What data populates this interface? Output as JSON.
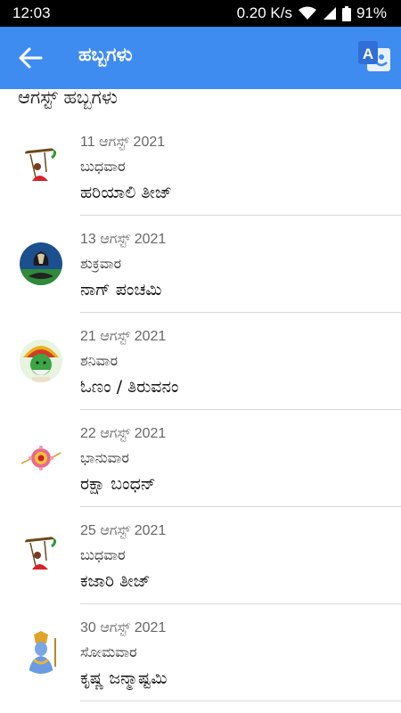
{
  "status": {
    "time": "12:03",
    "speed": "0.20 K/s",
    "battery": "91%"
  },
  "appbar": {
    "title": "ಹಬ್ಬಗಳು",
    "back_icon": "back-arrow-icon",
    "translate_icon": "translate-icon",
    "color": "#3f8cf0"
  },
  "section": {
    "header": "ಆಗಸ್ಟ್ ಹಬ್ಬಗಳು"
  },
  "festivals": [
    {
      "date": "11 ಆಗಸ್ಟ್ 2021",
      "day": "ಬುಧವಾರ",
      "name": "ಹರಿಯಾಲಿ ತೀಜ್",
      "icon": "swing-woman-icon"
    },
    {
      "date": "13 ಆಗಸ್ಟ್ 2021",
      "day": "ಶುಕ್ರವಾರ",
      "name": "ನಾಗ್ ಪಂಚಮಿ",
      "icon": "cobra-icon"
    },
    {
      "date": "21 ಆಗಸ್ಟ್ 2021",
      "day": "ಶನಿವಾರ",
      "name": "ಓಣಂ / ತಿರುವನಂ",
      "icon": "kathakali-icon"
    },
    {
      "date": "22 ಆಗಸ್ಟ್ 2021",
      "day": "ಭಾನುವಾರ",
      "name": "ರಕ್ಷಾ ಬಂಧನ್",
      "icon": "rakhi-icon"
    },
    {
      "date": "25 ಆಗಸ್ಟ್ 2021",
      "day": "ಬುಧವಾರ",
      "name": "ಕಜಾರಿ ತೀಜ್",
      "icon": "swing-woman-icon"
    },
    {
      "date": "30 ಆಗಸ್ಟ್ 2021",
      "day": "ಸೋಮವಾರ",
      "name": "ಕೃಷ್ಣ ಜನ್ಮಾಷ್ಟಮಿ",
      "icon": "krishna-icon"
    }
  ]
}
